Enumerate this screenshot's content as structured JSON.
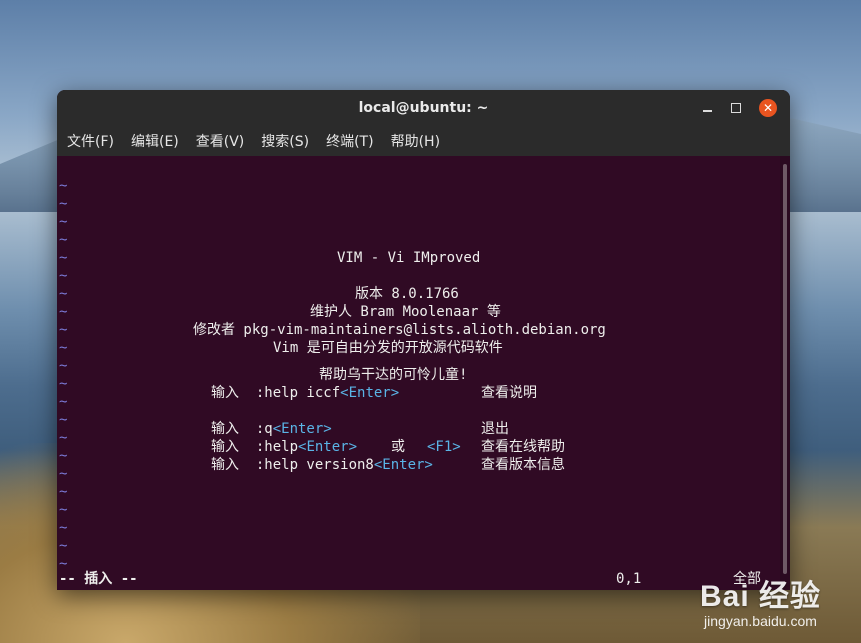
{
  "window": {
    "title": "local@ubuntu: ~",
    "minimize_glyph": "",
    "close_glyph": "✕"
  },
  "menu": [
    "文件(F)",
    "编辑(E)",
    "查看(V)",
    "搜索(S)",
    "终端(T)",
    "帮助(H)"
  ],
  "vim": {
    "tilde": "~",
    "title": "VIM - Vi IMproved",
    "version_label": "版本 8.0.1766",
    "maintainer": "维护人 Bram Moolenaar 等",
    "modifier": "修改者 pkg-vim-maintainers@lists.alioth.debian.org",
    "license": "Vim 是可自由分发的开放源代码软件",
    "help_uganda": "帮助乌干达的可怜儿童!",
    "hint1": {
      "prefix": "输入  :help iccf",
      "key": "<Enter>",
      "desc": "查看说明"
    },
    "hint2": {
      "prefix": "输入  :q",
      "key": "<Enter>",
      "desc": "退出"
    },
    "hint3": {
      "prefix": "输入  :help",
      "key": "<Enter>",
      "or": "或",
      "key2": "<F1>",
      "desc": "查看在线帮助"
    },
    "hint4": {
      "prefix": "输入  :help version8",
      "key": "<Enter>",
      "desc": "查看版本信息"
    },
    "mode": "-- 插入 --",
    "cursor_pos": "0,1",
    "scroll_pos": "全部"
  },
  "watermark": {
    "logo": "Bai 经验",
    "url": "jingyan.baidu.com"
  }
}
